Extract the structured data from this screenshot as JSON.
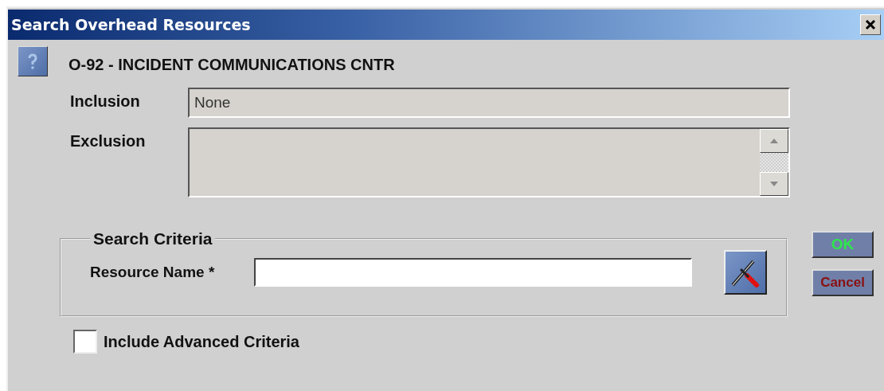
{
  "window": {
    "title": "Search Overhead Resources"
  },
  "heading": "O-92 - INCIDENT COMMUNICATIONS CNTR",
  "inclusion": {
    "label": "Inclusion",
    "value": "None"
  },
  "exclusion": {
    "label": "Exclusion"
  },
  "search_criteria": {
    "title": "Search Criteria",
    "resource_name": {
      "label": "Resource Name *"
    }
  },
  "buttons": [
    {
      "label": "OK",
      "kind": "ok"
    },
    {
      "label": "Cancel",
      "kind": "cancel"
    }
  ],
  "advanced": {
    "label": "Include Advanced Criteria",
    "checked": false
  }
}
